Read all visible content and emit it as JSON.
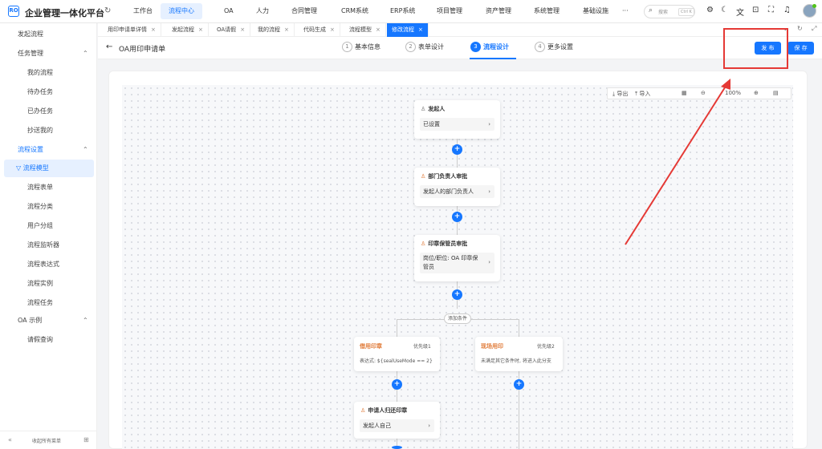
{
  "app": {
    "logo": "RO",
    "title": "企业管理一体化平台",
    "refresh_icon": "refresh-icon"
  },
  "topnav": {
    "items": [
      "工作台",
      "流程中心",
      "OA",
      "人力",
      "合同管理",
      "CRM系统",
      "ERP系统",
      "项目管理",
      "资产管理",
      "系统管理",
      "基础设施",
      "···"
    ],
    "active": "流程中心"
  },
  "search": {
    "placeholder": "搜索",
    "shortcut": "Ctrl K"
  },
  "toolbar": {
    "icons": [
      "gear-icon",
      "moon-icon",
      "translate-icon",
      "lock-icon",
      "fullscreen-icon",
      "bell-icon"
    ]
  },
  "sidebar": {
    "items": [
      {
        "label": "发起流程",
        "level": 0
      },
      {
        "label": "任务管理",
        "level": 0,
        "group": true,
        "open": false
      },
      {
        "label": "我的流程",
        "level": 1
      },
      {
        "label": "待办任务",
        "level": 1
      },
      {
        "label": "已办任务",
        "level": 1
      },
      {
        "label": "抄送我的",
        "level": 1
      },
      {
        "label": "流程设置",
        "level": 0,
        "group": true,
        "open": true
      },
      {
        "label": "流程模型",
        "level": 1,
        "active": true
      },
      {
        "label": "流程表单",
        "level": 1
      },
      {
        "label": "流程分类",
        "level": 1
      },
      {
        "label": "用户分组",
        "level": 1
      },
      {
        "label": "流程监听器",
        "level": 1
      },
      {
        "label": "流程表达式",
        "level": 1
      },
      {
        "label": "流程实例",
        "level": 1
      },
      {
        "label": "流程任务",
        "level": 1
      },
      {
        "label": "OA 示例",
        "level": 0,
        "group": true,
        "open": false
      },
      {
        "label": "请假查询",
        "level": 1
      }
    ],
    "footer": {
      "left_icon": "collapse-icon",
      "label": "收起所有菜单",
      "right_icon": "pin-icon"
    }
  },
  "tabs": [
    {
      "label": "用印申请单详情"
    },
    {
      "label": "发起流程"
    },
    {
      "label": "OA请假"
    },
    {
      "label": "我的流程"
    },
    {
      "label": "代码生成"
    },
    {
      "label": "流程模型"
    },
    {
      "label": "修改流程",
      "active": true
    }
  ],
  "header": {
    "back_icon": "back-arrow-icon",
    "title": "OA用印申请单",
    "steps": [
      {
        "num": "1",
        "label": "基本信息"
      },
      {
        "num": "2",
        "label": "表单设计"
      },
      {
        "num": "3",
        "label": "流程设计",
        "active": true
      },
      {
        "num": "4",
        "label": "更多设置"
      }
    ],
    "publish": "发 布",
    "save": "保 存"
  },
  "canvas_toolbar": {
    "export": "导出",
    "import": "导入",
    "zoom": "100%"
  },
  "flow": {
    "start": {
      "title": "发起人",
      "value": "已设置"
    },
    "n1": {
      "title": "部门负责人审批",
      "value": "发起人的部门负责人"
    },
    "n2": {
      "title": "印章保管员审批",
      "value": "岗位/职位: OA 印章保管员"
    },
    "branch": "添加条件",
    "cond1": {
      "title": "借用印章",
      "priority": "优先级1",
      "expr": "表达式: ${sealUseMode == 2}"
    },
    "cond2": {
      "title": "现场用印",
      "priority": "优先级2",
      "expr": "未满足其它条件时, 将进入此分支"
    },
    "n3": {
      "title": "申请人归还印章",
      "value": "发起人自己"
    }
  },
  "annotation": {
    "color": "#e53935"
  }
}
